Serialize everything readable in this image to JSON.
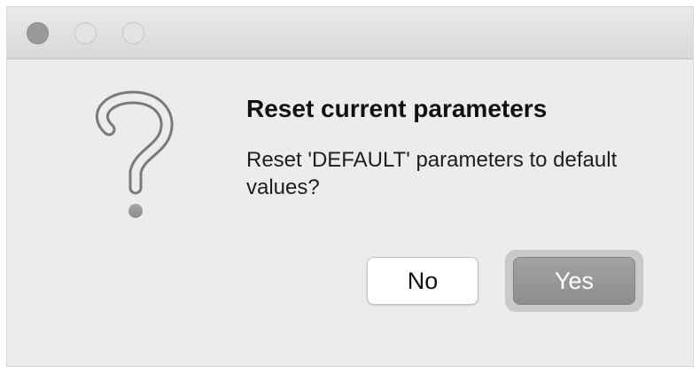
{
  "window": {
    "controls": [
      "close",
      "minimize",
      "zoom"
    ]
  },
  "dialog": {
    "icon": "question-mark-icon",
    "title": "Reset current parameters",
    "message": "Reset 'DEFAULT' parameters to default values?"
  },
  "buttons": {
    "no_label": "No",
    "yes_label": "Yes",
    "default": "yes"
  },
  "colors": {
    "window_bg": "#ececec",
    "titlebar_bg": "#dcdcdc",
    "default_button_bg": "#969696",
    "icon_gray": "#8f8f8f"
  }
}
